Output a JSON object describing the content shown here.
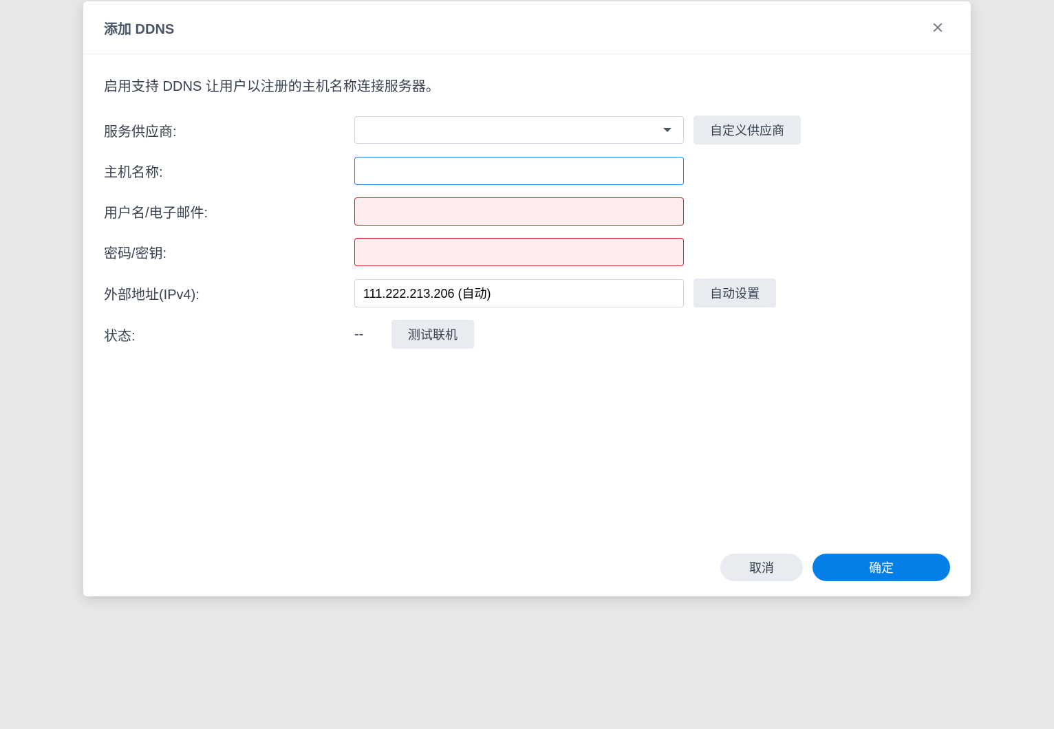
{
  "dialog": {
    "title": "添加 DDNS",
    "description": "启用支持 DDNS 让用户以注册的主机名称连接服务器。"
  },
  "form": {
    "provider": {
      "label": "服务供应商:",
      "value": "",
      "custom_button": "自定义供应商"
    },
    "hostname": {
      "label": "主机名称:",
      "value": ""
    },
    "username": {
      "label": "用户名/电子邮件:",
      "value": ""
    },
    "password": {
      "label": "密码/密钥:",
      "value": ""
    },
    "external_ip": {
      "label": "外部地址(IPv4):",
      "value": "111.222.213.206 (自动)",
      "auto_button": "自动设置"
    },
    "status": {
      "label": "状态:",
      "value": "--",
      "test_button": "测试联机"
    }
  },
  "footer": {
    "cancel": "取消",
    "ok": "确定"
  }
}
